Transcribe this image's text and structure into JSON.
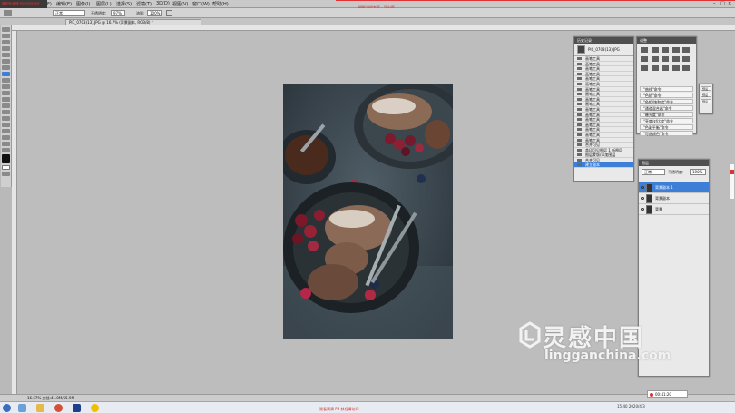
{
  "titlebar": {
    "menus": [
      "文件(F)",
      "编辑(E)",
      "图像(I)",
      "图层(L)",
      "选择(S)",
      "滤镜(T)",
      "3D(D)",
      "视图(V)",
      "窗口(W)",
      "帮助(H)"
    ],
    "center_text": "摄影课程专家 · 导出版",
    "overlay_text": "微信号/微博 PS@@@@@"
  },
  "options": {
    "mode": "正常",
    "opacity_label": "不透明度:",
    "opacity": "97%",
    "flow_label": "流量:",
    "flow": "100%"
  },
  "document_tab": "PIC_0703(13).JPG @ 16.7% (背景副本, RGB/8) *",
  "statusbar": "16.67%  文档:41.0M/55.9M",
  "history": {
    "title": "历史记录",
    "snapshot": "PIC_0703(13).JPG",
    "items": [
      "画笔工具",
      "画笔工具",
      "画笔工具",
      "画笔工具",
      "画笔工具",
      "画笔工具",
      "画笔工具",
      "画笔工具",
      "画笔工具",
      "画笔工具",
      "画笔工具",
      "画笔工具",
      "画笔工具",
      "画笔工具",
      "画笔工具",
      "画笔工具",
      "画笔工具",
      "合并可见",
      "盖印可见图层 1 新图层",
      "图层蒙版/添加图层",
      "合并可见",
      "建立副本"
    ],
    "selected_index": 21
  },
  "adjustments": {
    "title": "调整",
    "actions": [
      "\"曲线\"命令",
      "\"色阶\"命令",
      "\"色相/饱和度\"命令",
      "\"通道混合器\"命令",
      "\"曝光度\"命令",
      "\"亮度/对比度\"命令",
      "\"色彩平衡\"命令",
      "\"可选颜色\"命令"
    ]
  },
  "swatches": [
    "预设",
    "预设",
    "预设"
  ],
  "layers": {
    "title": "图层",
    "blend_mode": "正常",
    "opacity_label": "不透明度:",
    "opacity": "100%",
    "rows": [
      {
        "name": "背景副本 1",
        "selected": true
      },
      {
        "name": "背景副本",
        "selected": false
      },
      {
        "name": "背景",
        "selected": false
      }
    ]
  },
  "taskbar": {
    "center_text": "观看高清 PS 教程请访问",
    "tray_time": "15:40",
    "tray_date": "2020/4/3",
    "recorder": "00:41:20"
  },
  "watermark": {
    "name": "灵感中国",
    "url": "lingganchina.com"
  },
  "colors": {
    "panel_header": "#4f4f4f",
    "selection": "#3d7fd6",
    "canvas": "#bdbdbd"
  }
}
